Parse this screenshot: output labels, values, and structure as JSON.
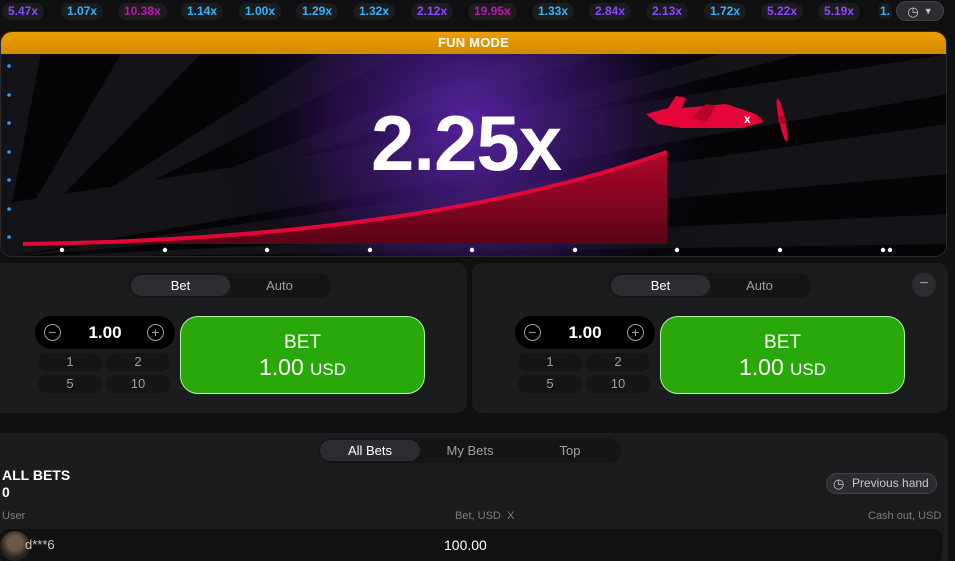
{
  "history": {
    "items": [
      {
        "value": "5.47x",
        "color": "#8f48ff"
      },
      {
        "value": "1.07x",
        "color": "#34b4ff"
      },
      {
        "value": "10.38x",
        "color": "#c017b4"
      },
      {
        "value": "1.14x",
        "color": "#34b4ff"
      },
      {
        "value": "1.00x",
        "color": "#34b4ff"
      },
      {
        "value": "1.29x",
        "color": "#34b4ff"
      },
      {
        "value": "1.32x",
        "color": "#34b4ff"
      },
      {
        "value": "2.12x",
        "color": "#8f48ff"
      },
      {
        "value": "19.95x",
        "color": "#c017b4"
      },
      {
        "value": "1.33x",
        "color": "#34b4ff"
      },
      {
        "value": "2.84x",
        "color": "#8f48ff"
      },
      {
        "value": "2.13x",
        "color": "#8f48ff"
      },
      {
        "value": "1.72x",
        "color": "#34b4ff"
      },
      {
        "value": "5.22x",
        "color": "#8f48ff"
      },
      {
        "value": "5.19x",
        "color": "#8f48ff"
      },
      {
        "value": "1.",
        "color": "#34b4ff"
      }
    ],
    "history_icon": "history-clock-icon",
    "dropdown_icon": "chevron-down-icon"
  },
  "stage": {
    "mode_label": "FUN MODE",
    "multiplier": "2.25x",
    "plane_icon": "airplane-icon",
    "accent_color": "#e50539"
  },
  "bet_panels": [
    {
      "tabs": [
        "Bet",
        "Auto"
      ],
      "active_tab": "Bet",
      "stake": "1.00",
      "quick_amounts": [
        "1",
        "2",
        "5",
        "10"
      ],
      "bet_label": "BET",
      "bet_amount": "1.00",
      "currency": "USD"
    },
    {
      "tabs": [
        "Bet",
        "Auto"
      ],
      "active_tab": "Bet",
      "stake": "1.00",
      "quick_amounts": [
        "1",
        "2",
        "5",
        "10"
      ],
      "bet_label": "BET",
      "bet_amount": "1.00",
      "currency": "USD"
    }
  ],
  "bets": {
    "tabs": [
      "All Bets",
      "My Bets",
      "Top"
    ],
    "active_tab": "All Bets",
    "title": "ALL BETS",
    "count": "0",
    "previous_hand": "Previous hand",
    "columns": {
      "user": "User",
      "bet": "Bet, USD",
      "x": "X",
      "cashout": "Cash out, USD"
    },
    "rows": [
      {
        "user": "d***6",
        "bet": "100.00"
      }
    ]
  }
}
